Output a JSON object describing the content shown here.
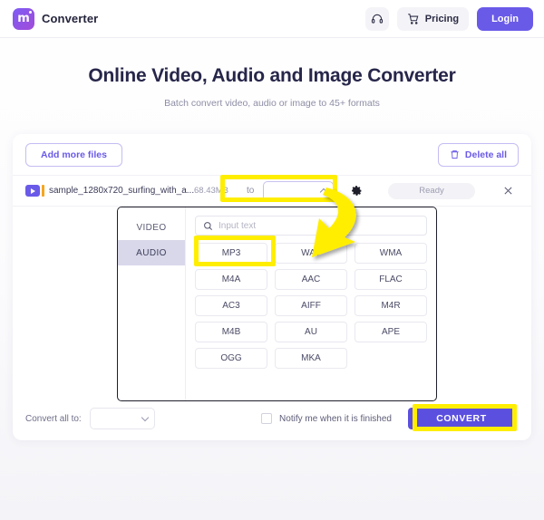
{
  "header": {
    "brand_name": "Converter",
    "logo_letter": "m",
    "support_icon": "headset-icon",
    "pricing_label": "Pricing",
    "cart_icon": "cart-icon",
    "login_label": "Login"
  },
  "hero": {
    "title": "Online Video, Audio and Image Converter",
    "subtitle": "Batch convert video, audio or image to 45+ formats"
  },
  "toolbar": {
    "add_more_files_label": "Add more files",
    "delete_all_label": "Delete all",
    "trash_icon": "trash-icon"
  },
  "file_row": {
    "file_icon": "video-file-icon",
    "file_name": "sample_1280x720_surfing_with_a...",
    "file_size": "68.43MB",
    "to_label": "to",
    "target_format_value": "",
    "chevron_icon": "chevron-up-icon",
    "settings_icon": "gear-icon",
    "status": "Ready",
    "close_icon": "close-icon"
  },
  "dropdown": {
    "tabs": [
      {
        "label": "VIDEO",
        "active": false
      },
      {
        "label": "AUDIO",
        "active": true
      }
    ],
    "search_placeholder": "Input text",
    "search_value": "",
    "search_icon": "search-icon",
    "formats": [
      "MP3",
      "WAV",
      "WMA",
      "M4A",
      "AAC",
      "FLAC",
      "AC3",
      "AIFF",
      "M4R",
      "M4B",
      "AU",
      "APE",
      "OGG",
      "MKA"
    ],
    "selected_format": "MP3"
  },
  "bottom_bar": {
    "convert_all_label": "Convert all to:",
    "convert_all_value": "",
    "chevron_icon": "chevron-down-icon",
    "notify_label": "Notify me when it is finished",
    "notify_checked": false,
    "convert_label": "CONVERT"
  },
  "annotations": {
    "highlight_color": "#ffee00",
    "arrow_from": "format-dropdown-trigger",
    "arrow_to": "format-option-mp3"
  },
  "colors": {
    "brand_purple": "#6a5ae8",
    "convert_purple": "#5b4fe0",
    "highlight_yellow": "#ffee00",
    "tab_active_bg": "#d9d8ea"
  }
}
